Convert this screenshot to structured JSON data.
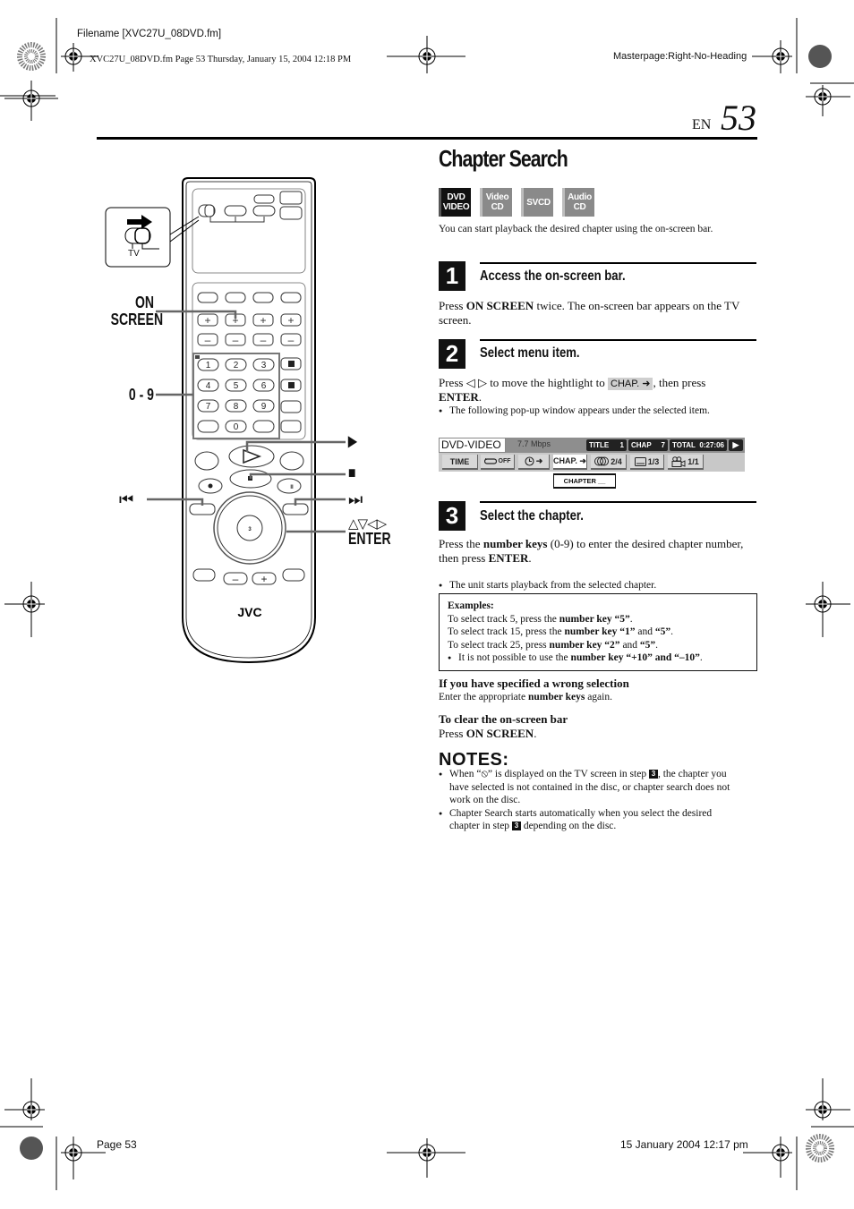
{
  "print_header": {
    "filename": "Filename [XVC27U_08DVD.fm]",
    "file_info": "XVC27U_08DVD.fm  Page 53  Thursday, January 15, 2004  12:18 PM",
    "masterpage": "Masterpage:Right-No-Heading"
  },
  "page_header": {
    "lang": "EN",
    "page_number": "53"
  },
  "title": "Chapter Search",
  "disc_badges": [
    {
      "line1": "DVD",
      "line2": "VIDEO",
      "active": true
    },
    {
      "line1": "Video",
      "line2": "CD",
      "active": false
    },
    {
      "line1": "SVCD",
      "line2": "",
      "active": false
    },
    {
      "line1": "Audio",
      "line2": "CD",
      "active": false
    }
  ],
  "intro": "You can start playback the desired chapter using the on-screen bar.",
  "steps": [
    {
      "number": "1",
      "heading": "Access the on-screen bar.",
      "text_pre": "Press ",
      "text_bold": "ON SCREEN",
      "text_post": " twice. The on-screen bar appears on the TV screen."
    },
    {
      "number": "2",
      "heading": "Select menu item.",
      "text_pre": "Press ◁ ▷ to move the hightlight to ",
      "chip": "CHAP. ➜",
      "text_mid": ", then press ",
      "text_bold": "ENTER",
      "text_post": ".",
      "bullet": "The following pop-up window appears under the selected item."
    },
    {
      "number": "3",
      "heading": "Select the chapter.",
      "text_pre": "Press the ",
      "text_bold1": "number keys",
      "text_mid": " (0-9) to enter the desired chapter number, then press ",
      "text_bold2": "ENTER",
      "text_post": ".",
      "bullet": "The unit starts playback from the selected chapter."
    }
  ],
  "osd": {
    "mode": "DVD-VIDEO",
    "bitrate": "7.7 Mbps",
    "title_label": "TITLE",
    "title_value": "1",
    "chap_label": "CHAP",
    "chap_value": "7",
    "total_label": "TOTAL",
    "total_value": "0:27:06",
    "play_icon": "▶",
    "buttons": [
      {
        "label": "TIME"
      },
      {
        "label": "OFF",
        "icon": "repeat-icon"
      },
      {
        "label": "➜",
        "icon": "clock-icon"
      },
      {
        "label": "CHAP. ➜",
        "selected": true
      },
      {
        "label": "2/4",
        "icon": "audio-icon"
      },
      {
        "label": "1/3",
        "icon": "subtitle-icon"
      },
      {
        "label": "1/1",
        "icon": "angle-icon"
      }
    ],
    "popup": "CHAPTER __"
  },
  "examples": {
    "title": "Examples:",
    "lines": [
      {
        "pre": "To select track 5, press the ",
        "bold": "number key “5”",
        "post": "."
      },
      {
        "pre": "To select track 15, press the ",
        "bold": "number key “1”",
        "mid": " and ",
        "bold2": "“5”",
        "post": "."
      },
      {
        "pre": "To select track 25, press ",
        "bold": "number key “2”",
        "mid": " and ",
        "bold2": "“5”",
        "post": "."
      }
    ],
    "bullet_pre": "It is not possible to use the ",
    "bullet_bold": "number key “+10” and “–10”",
    "bullet_post": "."
  },
  "wrong_selection": {
    "heading": "If you have specified a wrong selection",
    "pre": "Enter the appropriate ",
    "bold": "number keys",
    "post": " again."
  },
  "clear_bar": {
    "heading": "To clear the on-screen bar",
    "pre": "Press ",
    "bold": "ON SCREEN",
    "post": "."
  },
  "notes": {
    "title": "NOTES:",
    "items": [
      {
        "pre": "When “⦸” is displayed on the TV screen in step ",
        "step": "3",
        "post": ", the chapter you have selected is not contained in the disc, or chapter search does not work on the disc."
      },
      {
        "pre": "Chapter Search starts automatically when you select the desired chapter in step ",
        "step": "3",
        "post": " depending on the disc."
      }
    ]
  },
  "remote": {
    "brand": "JVC",
    "switch_label": "TV",
    "labels": {
      "on_screen_1": "ON",
      "on_screen_2": "SCREEN",
      "num_keys": "0 - 9",
      "play": "▶",
      "stop": "■",
      "prev": "⏮",
      "next": "⏭",
      "arrows": "△▽◁▷",
      "enter": "ENTER"
    },
    "keys": [
      "1",
      "2",
      "3",
      "4",
      "5",
      "6",
      "7",
      "8",
      "9",
      "0"
    ]
  },
  "footer": {
    "page": "Page 53",
    "date": "15 January 2004 12:17 pm"
  }
}
